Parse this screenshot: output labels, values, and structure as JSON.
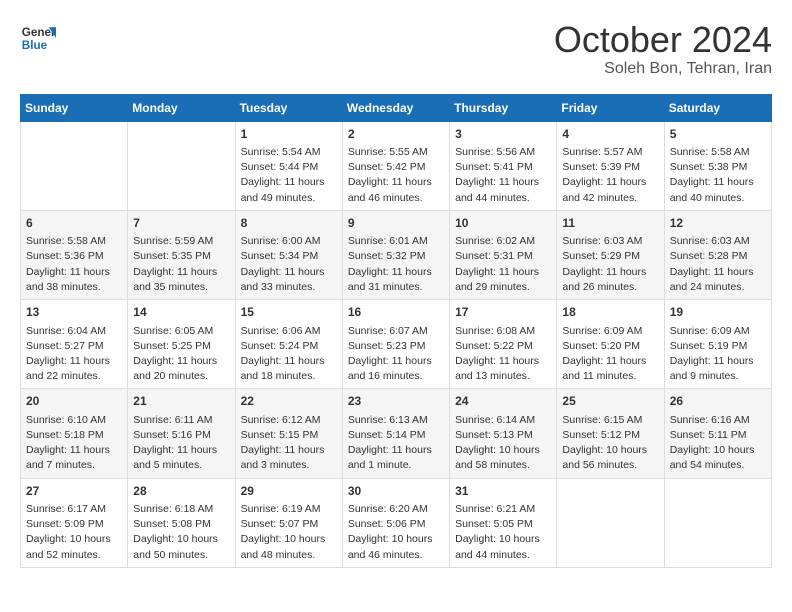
{
  "logo": {
    "line1": "General",
    "line2": "Blue"
  },
  "title": "October 2024",
  "subtitle": "Soleh Bon, Tehran, Iran",
  "weekdays": [
    "Sunday",
    "Monday",
    "Tuesday",
    "Wednesday",
    "Thursday",
    "Friday",
    "Saturday"
  ],
  "weeks": [
    [
      {
        "day": "",
        "content": ""
      },
      {
        "day": "",
        "content": ""
      },
      {
        "day": "1",
        "content": "Sunrise: 5:54 AM\nSunset: 5:44 PM\nDaylight: 11 hours and 49 minutes."
      },
      {
        "day": "2",
        "content": "Sunrise: 5:55 AM\nSunset: 5:42 PM\nDaylight: 11 hours and 46 minutes."
      },
      {
        "day": "3",
        "content": "Sunrise: 5:56 AM\nSunset: 5:41 PM\nDaylight: 11 hours and 44 minutes."
      },
      {
        "day": "4",
        "content": "Sunrise: 5:57 AM\nSunset: 5:39 PM\nDaylight: 11 hours and 42 minutes."
      },
      {
        "day": "5",
        "content": "Sunrise: 5:58 AM\nSunset: 5:38 PM\nDaylight: 11 hours and 40 minutes."
      }
    ],
    [
      {
        "day": "6",
        "content": "Sunrise: 5:58 AM\nSunset: 5:36 PM\nDaylight: 11 hours and 38 minutes."
      },
      {
        "day": "7",
        "content": "Sunrise: 5:59 AM\nSunset: 5:35 PM\nDaylight: 11 hours and 35 minutes."
      },
      {
        "day": "8",
        "content": "Sunrise: 6:00 AM\nSunset: 5:34 PM\nDaylight: 11 hours and 33 minutes."
      },
      {
        "day": "9",
        "content": "Sunrise: 6:01 AM\nSunset: 5:32 PM\nDaylight: 11 hours and 31 minutes."
      },
      {
        "day": "10",
        "content": "Sunrise: 6:02 AM\nSunset: 5:31 PM\nDaylight: 11 hours and 29 minutes."
      },
      {
        "day": "11",
        "content": "Sunrise: 6:03 AM\nSunset: 5:29 PM\nDaylight: 11 hours and 26 minutes."
      },
      {
        "day": "12",
        "content": "Sunrise: 6:03 AM\nSunset: 5:28 PM\nDaylight: 11 hours and 24 minutes."
      }
    ],
    [
      {
        "day": "13",
        "content": "Sunrise: 6:04 AM\nSunset: 5:27 PM\nDaylight: 11 hours and 22 minutes."
      },
      {
        "day": "14",
        "content": "Sunrise: 6:05 AM\nSunset: 5:25 PM\nDaylight: 11 hours and 20 minutes."
      },
      {
        "day": "15",
        "content": "Sunrise: 6:06 AM\nSunset: 5:24 PM\nDaylight: 11 hours and 18 minutes."
      },
      {
        "day": "16",
        "content": "Sunrise: 6:07 AM\nSunset: 5:23 PM\nDaylight: 11 hours and 16 minutes."
      },
      {
        "day": "17",
        "content": "Sunrise: 6:08 AM\nSunset: 5:22 PM\nDaylight: 11 hours and 13 minutes."
      },
      {
        "day": "18",
        "content": "Sunrise: 6:09 AM\nSunset: 5:20 PM\nDaylight: 11 hours and 11 minutes."
      },
      {
        "day": "19",
        "content": "Sunrise: 6:09 AM\nSunset: 5:19 PM\nDaylight: 11 hours and 9 minutes."
      }
    ],
    [
      {
        "day": "20",
        "content": "Sunrise: 6:10 AM\nSunset: 5:18 PM\nDaylight: 11 hours and 7 minutes."
      },
      {
        "day": "21",
        "content": "Sunrise: 6:11 AM\nSunset: 5:16 PM\nDaylight: 11 hours and 5 minutes."
      },
      {
        "day": "22",
        "content": "Sunrise: 6:12 AM\nSunset: 5:15 PM\nDaylight: 11 hours and 3 minutes."
      },
      {
        "day": "23",
        "content": "Sunrise: 6:13 AM\nSunset: 5:14 PM\nDaylight: 11 hours and 1 minute."
      },
      {
        "day": "24",
        "content": "Sunrise: 6:14 AM\nSunset: 5:13 PM\nDaylight: 10 hours and 58 minutes."
      },
      {
        "day": "25",
        "content": "Sunrise: 6:15 AM\nSunset: 5:12 PM\nDaylight: 10 hours and 56 minutes."
      },
      {
        "day": "26",
        "content": "Sunrise: 6:16 AM\nSunset: 5:11 PM\nDaylight: 10 hours and 54 minutes."
      }
    ],
    [
      {
        "day": "27",
        "content": "Sunrise: 6:17 AM\nSunset: 5:09 PM\nDaylight: 10 hours and 52 minutes."
      },
      {
        "day": "28",
        "content": "Sunrise: 6:18 AM\nSunset: 5:08 PM\nDaylight: 10 hours and 50 minutes."
      },
      {
        "day": "29",
        "content": "Sunrise: 6:19 AM\nSunset: 5:07 PM\nDaylight: 10 hours and 48 minutes."
      },
      {
        "day": "30",
        "content": "Sunrise: 6:20 AM\nSunset: 5:06 PM\nDaylight: 10 hours and 46 minutes."
      },
      {
        "day": "31",
        "content": "Sunrise: 6:21 AM\nSunset: 5:05 PM\nDaylight: 10 hours and 44 minutes."
      },
      {
        "day": "",
        "content": ""
      },
      {
        "day": "",
        "content": ""
      }
    ]
  ]
}
